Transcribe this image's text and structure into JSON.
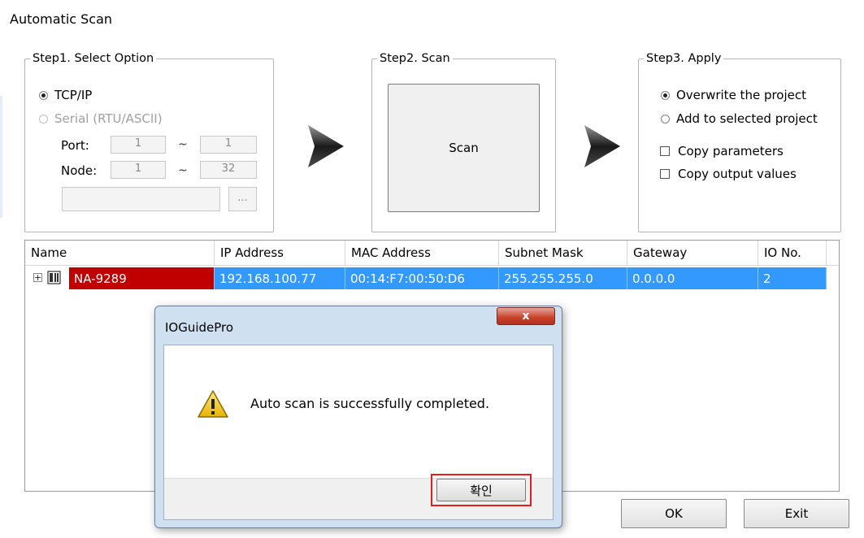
{
  "window": {
    "title": "Automatic Scan"
  },
  "step1": {
    "legend": "Step1. Select Option",
    "option_tcpip": "TCP/IP",
    "option_serial": "Serial (RTU/ASCII)",
    "port_label": "Port:",
    "port_from": "1",
    "port_to": "1",
    "node_label": "Node:",
    "node_from": "1",
    "node_to": "32",
    "range_sep": "~",
    "browse_label": "..."
  },
  "step2": {
    "legend": "Step2. Scan",
    "scan_label": "Scan"
  },
  "step3": {
    "legend": "Step3. Apply",
    "option_overwrite": "Overwrite the project",
    "option_add": "Add to selected project",
    "copy_parameters": "Copy parameters",
    "copy_outputs": "Copy output values"
  },
  "table": {
    "columns": [
      "Name",
      "IP Address",
      "MAC Address",
      "Subnet Mask",
      "Gateway",
      "IO No."
    ],
    "rows": [
      {
        "expander": "+",
        "name": "NA-9289",
        "ip": "192.168.100.77",
        "mac": "00:14:F7:00:50:D6",
        "subnet": "255.255.255.0",
        "gateway": "0.0.0.0",
        "io": "2"
      }
    ]
  },
  "buttons": {
    "ok": "OK",
    "exit": "Exit"
  },
  "dialog": {
    "title": "IOGuidePro",
    "close_label": "x",
    "message": "Auto scan is successfully completed.",
    "confirm_label": "확인",
    "icon": "warning-icon"
  },
  "colors": {
    "selection_blue": "#3399ff",
    "name_highlight": "#c00000",
    "highlight_box": "#e02020"
  }
}
